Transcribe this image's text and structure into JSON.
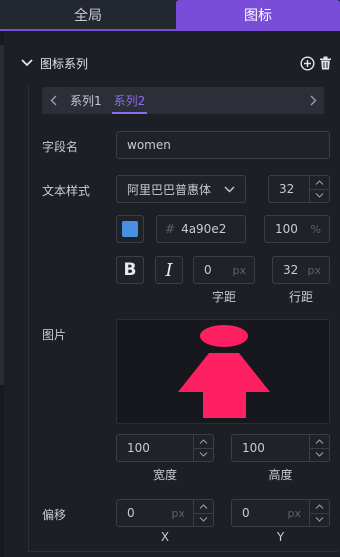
{
  "tabs": [
    {
      "label": "全局",
      "active": false
    },
    {
      "label": "图标",
      "active": true
    }
  ],
  "section": {
    "title": "图标系列",
    "icons": [
      "chevron-down-icon",
      "add-circle-icon",
      "trash-icon"
    ]
  },
  "series": {
    "tabs": [
      {
        "label": "系列1",
        "active": false
      },
      {
        "label": "系列2",
        "active": true
      }
    ]
  },
  "fields": {
    "field_name": {
      "label": "字段名",
      "value": "women"
    },
    "text_style": {
      "label": "文本样式",
      "font_family": "阿里巴巴普惠体",
      "font_size": "32",
      "color_hex_prefix": "#",
      "color_hex": "4a90e2",
      "color_swatch": "#4a90e2",
      "opacity": "100",
      "opacity_unit": "%",
      "bold_label": "B",
      "italic_label": "I",
      "letter_spacing": {
        "value": "0",
        "unit": "px",
        "label": "字距"
      },
      "line_height": {
        "value": "32",
        "unit": "px",
        "label": "行距"
      }
    },
    "image": {
      "label": "图片",
      "icon": "female-figure-icon",
      "icon_color": "#ff1f63",
      "width": {
        "value": "100",
        "label": "宽度"
      },
      "height": {
        "value": "100",
        "label": "高度"
      }
    },
    "offset": {
      "label": "偏移",
      "x": {
        "value": "0",
        "unit": "px",
        "label": "X"
      },
      "y": {
        "value": "0",
        "unit": "px",
        "label": "Y"
      }
    }
  },
  "colors": {
    "accent": "#7a4dd8",
    "accent_text": "#8b6cf0",
    "background": "#1c1f26"
  }
}
